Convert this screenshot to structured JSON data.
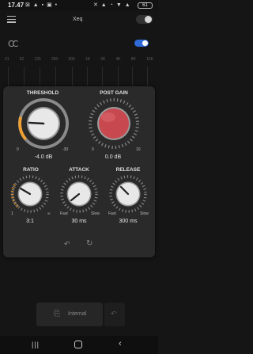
{
  "status_bar": {
    "time": "17.47",
    "left_icons": "⊠ ▲ ▪ ▣ •",
    "right_icons": "✕ ▲ ◔ ▼ ▲",
    "battery": "61"
  },
  "app": {
    "title": "Xeq"
  },
  "eq": {
    "logo_icon": "dual-c-logo-icon",
    "enabled": true,
    "frequency_labels": [
      "31",
      "62",
      "125",
      "250",
      "500",
      "1K",
      "2K",
      "4K",
      "8K",
      "16K"
    ]
  },
  "compressor": {
    "threshold": {
      "label": "THRESHOLD",
      "value": "-4.0 dB",
      "min_label": "0",
      "max_label": "-30"
    },
    "post_gain": {
      "label": "POST GAIN",
      "value": "0.0 dB",
      "min_label": "0",
      "max_label": "10"
    },
    "ratio": {
      "label": "RATIO",
      "value": "3:1",
      "min_label": "1",
      "max_label": "∞"
    },
    "attack": {
      "label": "ATTACK",
      "value": "30 ms",
      "min_label": "Fast",
      "max_label": "Slow"
    },
    "release": {
      "label": "RELEASE",
      "value": "300 ms",
      "min_label": "Fast",
      "max_label": "Slow"
    },
    "undo_icon": "↶",
    "reset_icon": "↻"
  },
  "bottom": {
    "internal_label": "Internal",
    "internal_icon": "⎘",
    "side_icon": "↶"
  },
  "nav": {
    "recent": "|||",
    "back": "‹"
  },
  "colors": {
    "accent_blue": "#2f6bd8",
    "post_gain_red": "#c8484f"
  }
}
